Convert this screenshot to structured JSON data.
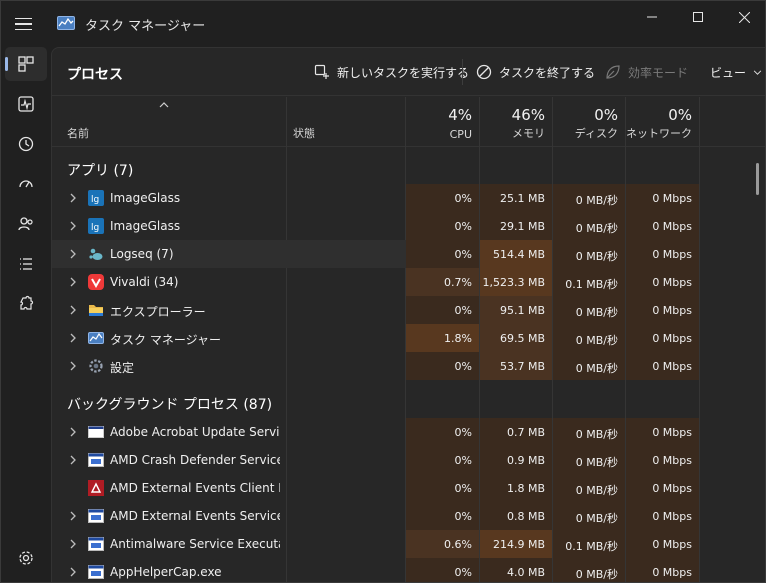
{
  "window": {
    "title": "タスク マネージャー"
  },
  "toolbar": {
    "page_title": "プロセス",
    "run_task": "新しいタスクを実行する",
    "end_task": "タスクを終了する",
    "efficiency": "効率モード",
    "view": "ビュー"
  },
  "header": {
    "name": "名前",
    "status": "状態",
    "cpu_pct": "4%",
    "cpu": "CPU",
    "mem_pct": "46%",
    "mem": "メモリ",
    "disk_pct": "0%",
    "disk": "ディスク",
    "net_pct": "0%",
    "net": "ネットワーク"
  },
  "groups": {
    "apps": "アプリ (7)",
    "background": "バックグラウンド プロセス (87)"
  },
  "apps": [
    {
      "name": "ImageGlass",
      "cpu": "0%",
      "mem": "25.1 MB",
      "disk": "0 MB/秒",
      "net": "0 Mbps",
      "icon": "imageglass-icon"
    },
    {
      "name": "ImageGlass",
      "cpu": "0%",
      "mem": "29.1 MB",
      "disk": "0 MB/秒",
      "net": "0 Mbps",
      "icon": "imageglass-icon"
    },
    {
      "name": "Logseq (7)",
      "cpu": "0%",
      "mem": "514.4 MB",
      "disk": "0 MB/秒",
      "net": "0 Mbps",
      "icon": "logseq-icon"
    },
    {
      "name": "Vivaldi (34)",
      "cpu": "0.7%",
      "mem": "1,523.3 MB",
      "disk": "0.1 MB/秒",
      "net": "0 Mbps",
      "icon": "vivaldi-icon"
    },
    {
      "name": "エクスプローラー",
      "cpu": "0%",
      "mem": "95.1 MB",
      "disk": "0 MB/秒",
      "net": "0 Mbps",
      "icon": "folder-icon"
    },
    {
      "name": "タスク マネージャー",
      "cpu": "1.8%",
      "mem": "69.5 MB",
      "disk": "0 MB/秒",
      "net": "0 Mbps",
      "icon": "task-manager-icon"
    },
    {
      "name": "設定",
      "cpu": "0%",
      "mem": "53.7 MB",
      "disk": "0 MB/秒",
      "net": "0 Mbps",
      "icon": "settings-gear-icon"
    }
  ],
  "background": [
    {
      "name": "Adobe Acrobat Update Servic...",
      "cpu": "0%",
      "mem": "0.7 MB",
      "disk": "0 MB/秒",
      "net": "0 Mbps",
      "icon": "window-icon"
    },
    {
      "name": "AMD Crash Defender Service",
      "cpu": "0%",
      "mem": "0.9 MB",
      "disk": "0 MB/秒",
      "net": "0 Mbps",
      "icon": "service-icon"
    },
    {
      "name": "AMD External Events Client M...",
      "cpu": "0%",
      "mem": "1.8 MB",
      "disk": "0 MB/秒",
      "net": "0 Mbps",
      "icon": "amd-icon"
    },
    {
      "name": "AMD External Events Service ...",
      "cpu": "0%",
      "mem": "0.8 MB",
      "disk": "0 MB/秒",
      "net": "0 Mbps",
      "icon": "service-icon"
    },
    {
      "name": "Antimalware Service Executable",
      "cpu": "0.6%",
      "mem": "214.9 MB",
      "disk": "0.1 MB/秒",
      "net": "0 Mbps",
      "icon": "service-icon"
    },
    {
      "name": "AppHelperCap.exe",
      "cpu": "0%",
      "mem": "4.0 MB",
      "disk": "0 MB/秒",
      "net": "0 Mbps",
      "icon": "service-icon"
    }
  ],
  "colors": {
    "accent": "#9ab8e8",
    "heat_low": "#3a2a1e",
    "heat_mid": "#4a3322",
    "heat_high": "#58381f"
  }
}
